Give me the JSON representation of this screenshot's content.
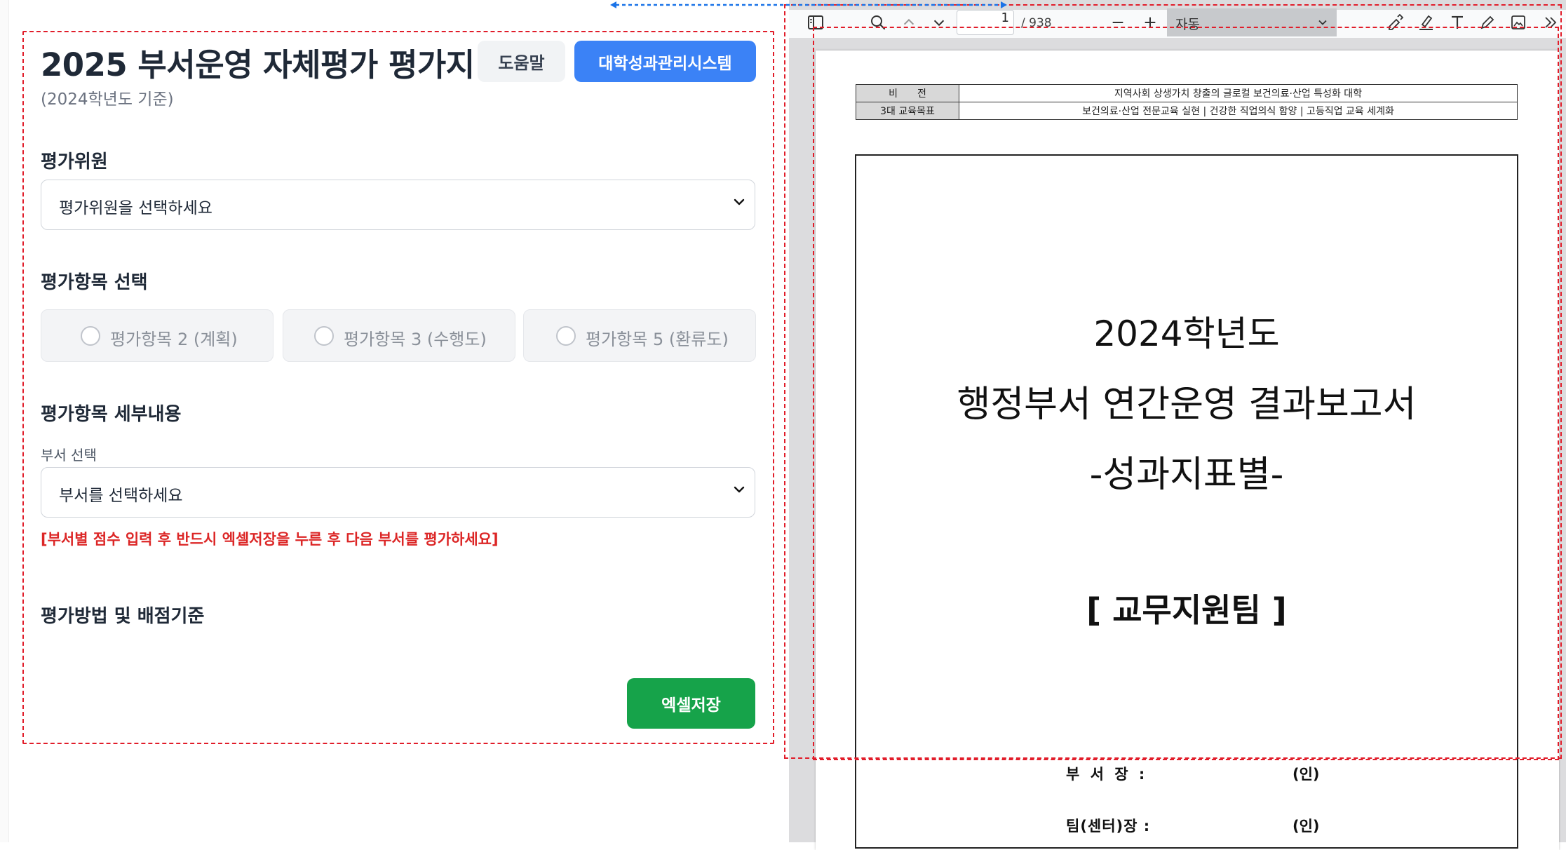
{
  "form": {
    "title": "2025 부서운영 자체평가 평가지",
    "subtitle": "(2024학년도 기준)",
    "help_button": "도움말",
    "system_button": "대학성과관리시스템",
    "evaluator": {
      "label": "평가위원",
      "placeholder": "평가위원을 선택하세요"
    },
    "items": {
      "label": "평가항목 선택",
      "options": [
        "평가항목 2 (계획)",
        "평가항목 3 (수행도)",
        "평가항목 5 (환류도)"
      ]
    },
    "details": {
      "label": "평가항목 세부내용",
      "dept_label": "부서 선택",
      "dept_placeholder": "부서를 선택하세요",
      "warning": "[부서별 점수 입력 후 반드시 엑셀저장을 누른 후 다음 부서를 평가하세요]"
    },
    "method_label": "평가방법 및 배점기준",
    "save_button": "엑셀저장"
  },
  "viewer": {
    "page_number": "1",
    "page_total": "/ 938",
    "zoom": "자동"
  },
  "document": {
    "vision_label": "비　　전",
    "vision_text": "지역사회 상생가치 창출의 글로컬 보건의료·산업 특성화 대학",
    "goals_label": "3대 교육목표",
    "goals_text": "보건의료·산업 전문교육 실현 | 건강한 직업의식 함양 | 고등직업 교육 세계화",
    "title_line1": "2024학년도",
    "title_line2": "행정부서 연간운영 결과보고서",
    "title_line3": "-성과지표별-",
    "team": "[ 교무지원팀 ]",
    "sign1_label": "부 서 장 :",
    "sign1_seal": "(인)",
    "sign2_label": "팀(센터)장 :",
    "sign2_seal": "(인)"
  },
  "colors": {
    "primary_blue": "#3b82f6",
    "excel_green": "#16a34a",
    "warning_red": "#dc2626",
    "annotation_red": "#e11d2a",
    "splitter_blue": "#1a73e8"
  },
  "icons": [
    "sidebar-toggle-icon",
    "search-icon",
    "chevron-up-icon",
    "chevron-down-icon",
    "minus-icon",
    "plus-icon",
    "edit-sign-icon",
    "highlight-icon",
    "text-icon",
    "draw-icon",
    "image-icon",
    "more-tools-icon"
  ]
}
